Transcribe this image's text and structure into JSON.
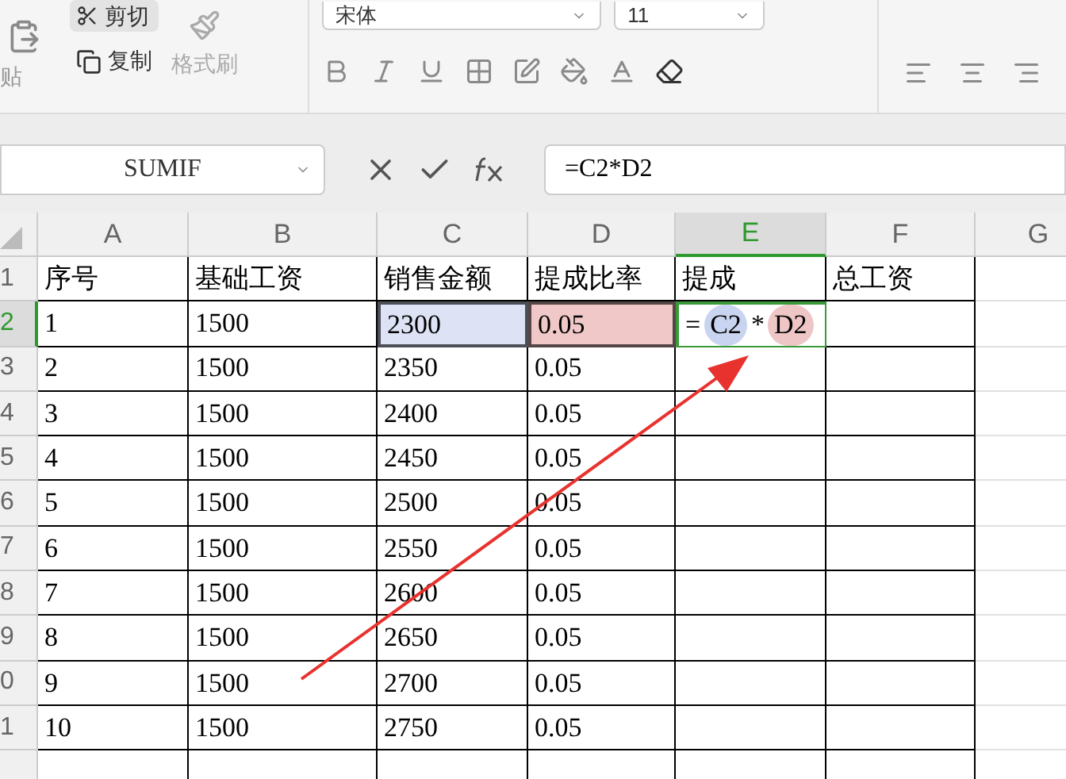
{
  "ribbon": {
    "clipboard": {
      "paste": "贴",
      "cut": "剪切",
      "copy": "复制",
      "format_painter": "格式刷",
      "format_painter_disabled": true
    },
    "font": {
      "family": "宋体",
      "size": "11"
    }
  },
  "formula_bar": {
    "name_box": "SUMIF",
    "formula": "=C2*D2"
  },
  "columns": [
    {
      "label": "A",
      "selected": false
    },
    {
      "label": "B",
      "selected": false
    },
    {
      "label": "C",
      "selected": false
    },
    {
      "label": "D",
      "selected": false
    },
    {
      "label": "E",
      "selected": true
    },
    {
      "label": "F",
      "selected": false
    },
    {
      "label": "G",
      "selected": false
    }
  ],
  "rows": [
    {
      "header": "1",
      "selected": false,
      "cells": [
        "序号",
        "基础工资",
        "销售金额",
        "提成比率",
        "提成",
        "总工资"
      ]
    },
    {
      "header": "2",
      "selected": true,
      "cells": [
        "1",
        "1500",
        {
          "kind": "ref",
          "text": "2300",
          "color": "#dde3f5"
        },
        {
          "kind": "ref",
          "text": "0.05",
          "color": "#f0c8c8"
        },
        {
          "kind": "formula",
          "parts": [
            {
              "text": "="
            },
            {
              "text": "C2",
              "color": "#c9d4f0"
            },
            {
              "text": "*"
            },
            {
              "text": "D2",
              "color": "#efc6c6"
            }
          ]
        }
      ]
    },
    {
      "header": "3",
      "selected": false,
      "cells": [
        "2",
        "1500",
        "2350",
        "0.05"
      ]
    },
    {
      "header": "4",
      "selected": false,
      "cells": [
        "3",
        "1500",
        "2400",
        "0.05"
      ]
    },
    {
      "header": "5",
      "selected": false,
      "cells": [
        "4",
        "1500",
        "2450",
        "0.05"
      ]
    },
    {
      "header": "6",
      "selected": false,
      "cells": [
        "5",
        "1500",
        "2500",
        "0.05"
      ]
    },
    {
      "header": "7",
      "selected": false,
      "cells": [
        "6",
        "1500",
        "2550",
        "0.05"
      ]
    },
    {
      "header": "8",
      "selected": false,
      "cells": [
        "7",
        "1500",
        "2600",
        "0.05"
      ]
    },
    {
      "header": "9",
      "selected": false,
      "cells": [
        "8",
        "1500",
        "2650",
        "0.05"
      ]
    },
    {
      "header": "0",
      "selected": false,
      "cells": [
        "9",
        "1500",
        "2700",
        "0.05"
      ]
    },
    {
      "header": "1",
      "selected": false,
      "cells": [
        "10",
        "1500",
        "2750",
        "0.05"
      ]
    }
  ]
}
